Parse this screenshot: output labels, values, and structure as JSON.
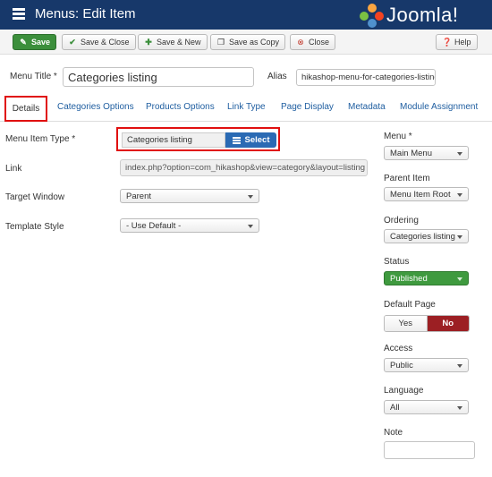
{
  "header": {
    "title": "Menus: Edit Item",
    "logo_text": "Joomla!",
    "bg_color": "#17386a",
    "icon": "menu-list-icon"
  },
  "toolbar": {
    "save_label": "Save",
    "save_close_label": "Save & Close",
    "save_new_label": "Save & New",
    "save_copy_label": "Save as Copy",
    "close_label": "Close",
    "help_label": "Help"
  },
  "form": {
    "menu_title_label": "Menu Title *",
    "menu_title_value": "Categories listing",
    "alias_label": "Alias",
    "alias_value": "hikashop-menu-for-categories-listing"
  },
  "tabs": [
    {
      "label": "Details",
      "active": true
    },
    {
      "label": "Categories Options"
    },
    {
      "label": "Products Options"
    },
    {
      "label": "Link Type"
    },
    {
      "label": "Page Display"
    },
    {
      "label": "Metadata"
    },
    {
      "label": "Module Assignment"
    }
  ],
  "details": {
    "menu_item_type_label": "Menu Item Type *",
    "menu_item_type_value": "Categories listing",
    "select_button_label": "Select",
    "link_label": "Link",
    "link_value": "index.php?option=com_hikashop&view=category&layout=listing",
    "target_window_label": "Target Window",
    "target_window_value": "Parent",
    "template_style_label": "Template Style",
    "template_style_value": "- Use Default -"
  },
  "sidebar": {
    "menu_label": "Menu *",
    "menu_value": "Main Menu",
    "parent_label": "Parent Item",
    "parent_value": "Menu Item Root",
    "ordering_label": "Ordering",
    "ordering_value": "Categories listing",
    "status_label": "Status",
    "status_value": "Published",
    "status_color": "#3f9a3f",
    "default_page_label": "Default Page",
    "default_yes": "Yes",
    "default_no": "No",
    "default_selected": "No",
    "access_label": "Access",
    "access_value": "Public",
    "language_label": "Language",
    "language_value": "All",
    "note_label": "Note",
    "note_value": ""
  },
  "colors": {
    "highlight": "#e01010",
    "link_blue": "#1f5ea0",
    "select_button": "#2a6ab4",
    "no_active": "#9c1f23"
  }
}
